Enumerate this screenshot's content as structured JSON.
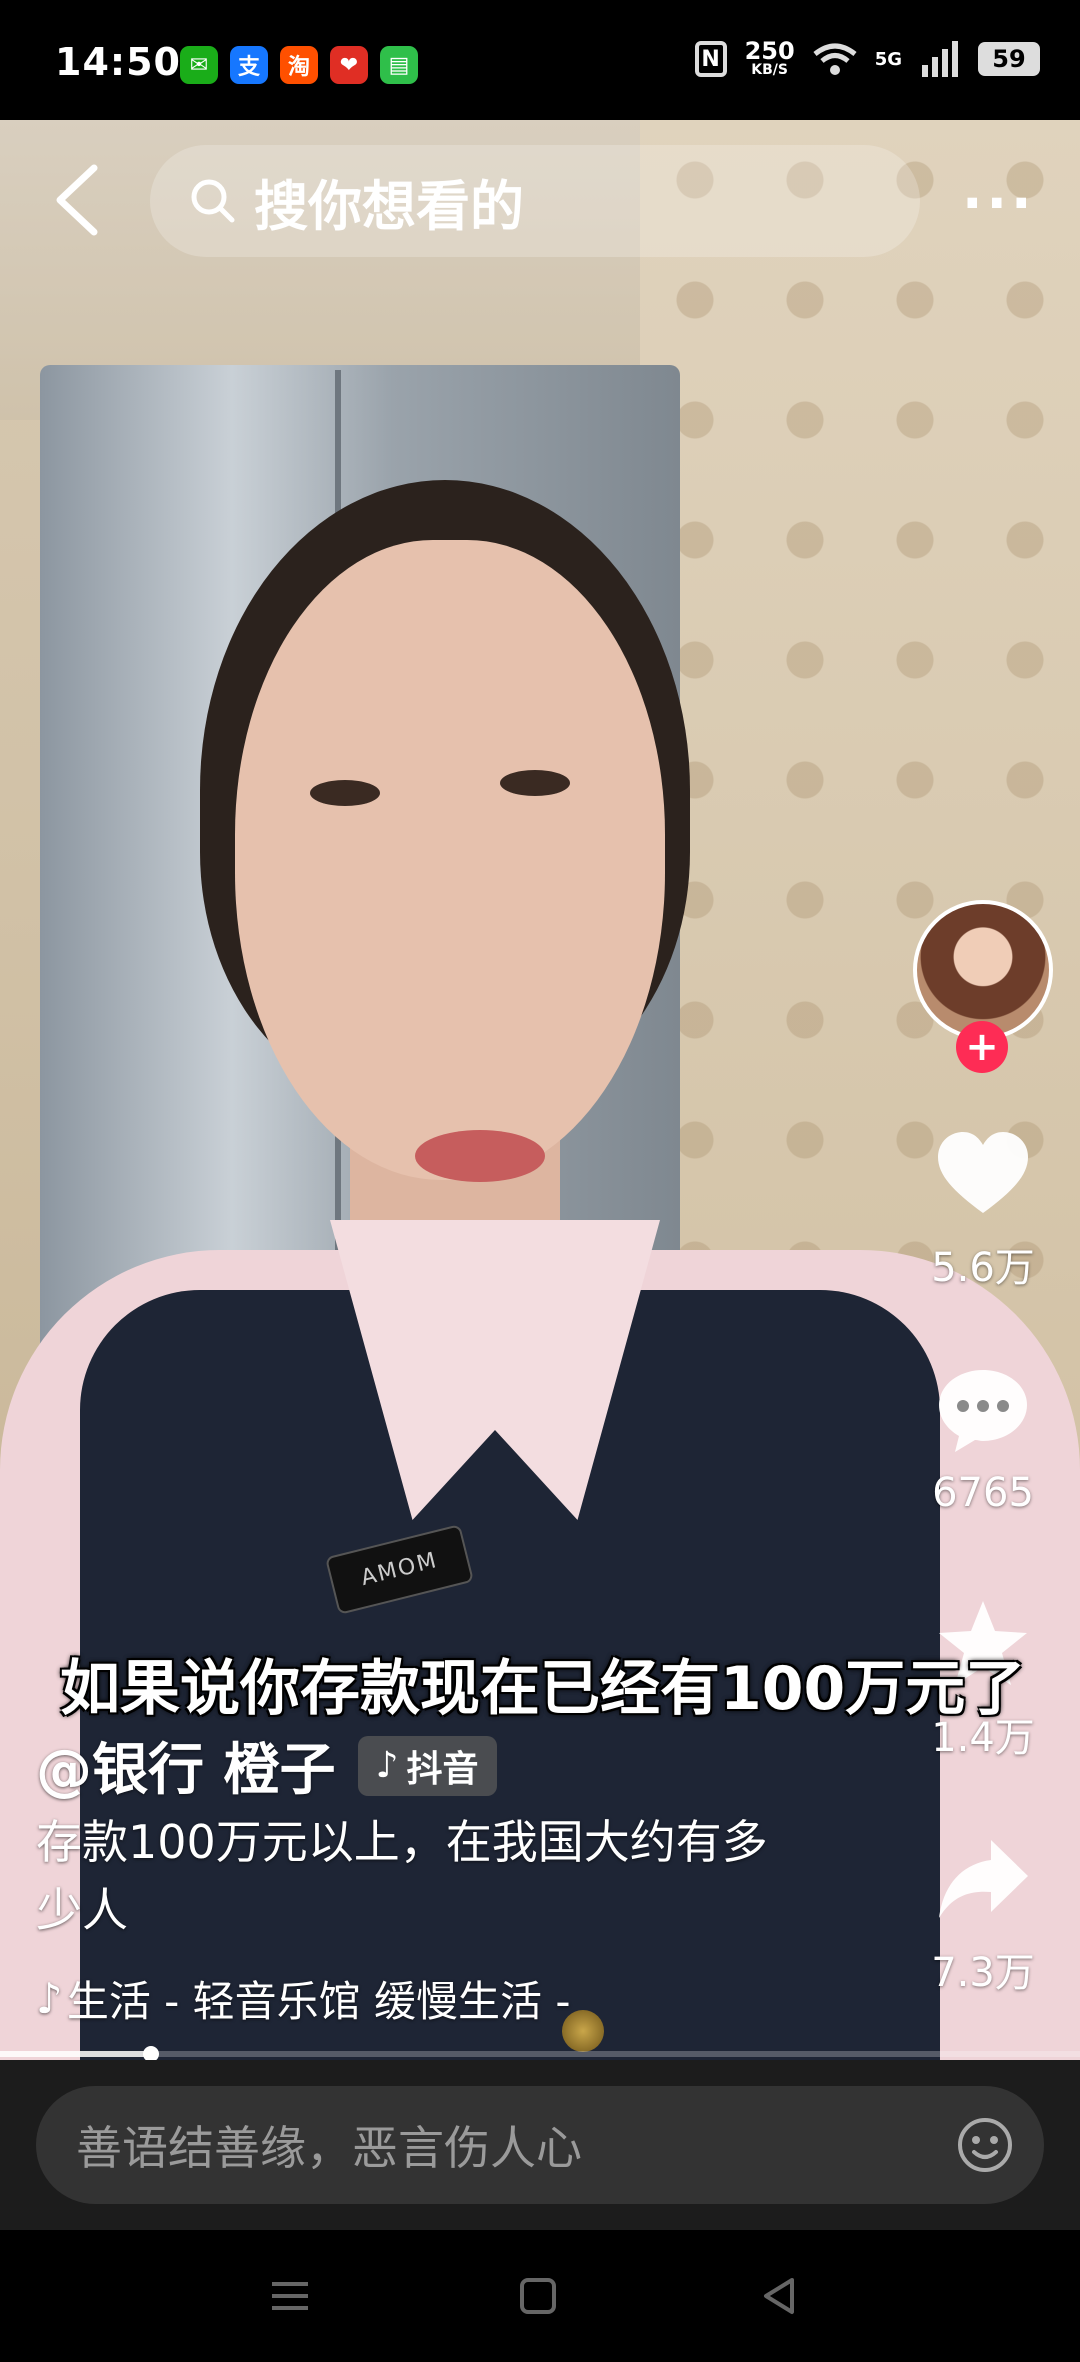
{
  "status_bar": {
    "time": "14:50",
    "apps": [
      {
        "name": "wechat-icon",
        "glyph": "✉",
        "color": "#1aad19"
      },
      {
        "name": "alipay-icon",
        "glyph": "支",
        "color": "#1677ff"
      },
      {
        "name": "taobao-icon",
        "glyph": "淘",
        "color": "#ff5000"
      },
      {
        "name": "pinduoduo-icon",
        "glyph": "❤",
        "color": "#e02e24"
      },
      {
        "name": "messages-icon",
        "glyph": "▤",
        "color": "#2fbf4a"
      }
    ],
    "nfc": "N",
    "speed_value": "250",
    "speed_unit": "KB/S",
    "network": "5G",
    "battery": "59"
  },
  "top_bar": {
    "search_placeholder": "搜你想看的",
    "more": "···"
  },
  "video": {
    "subtitle": "如果说你存款现在已经有100万元了",
    "mic_label": "AMOM"
  },
  "side_actions": {
    "likes": "5.6万",
    "comments": "6765",
    "favorites": "1.4万",
    "shares": "7.3万",
    "follow": "+"
  },
  "post": {
    "author": "@银行 橙子",
    "badge_text": "抖音",
    "description": "存款100万元以上，在我国大约有多少人",
    "music": "生活 - 轻音乐馆   缓慢生活 -",
    "progress": 0.14
  },
  "comment_bar": {
    "placeholder": "善语结善缘，恶言伤人心"
  }
}
